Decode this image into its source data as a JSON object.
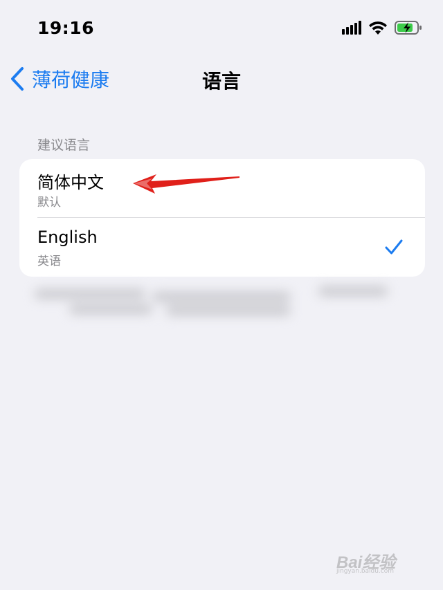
{
  "status_bar": {
    "time": "19:16"
  },
  "nav": {
    "back_label": "薄荷健康",
    "title": "语言"
  },
  "section": {
    "header": "建议语言"
  },
  "languages": [
    {
      "title": "简体中文",
      "subtitle": "默认",
      "selected": false
    },
    {
      "title": "English",
      "subtitle": "英语",
      "selected": true
    }
  ],
  "colors": {
    "accent": "#1c7cf0",
    "background": "#f1f1f6",
    "card": "#ffffff",
    "secondary_text": "#8a8a8e",
    "annotation": "#e0201a"
  },
  "icons": {
    "back": "chevron-left-icon",
    "check": "checkmark-icon",
    "signal": "cellular-signal-icon",
    "wifi": "wifi-icon",
    "battery": "battery-charging-icon",
    "annotation": "red-arrow-icon"
  },
  "watermark": {
    "text": "Bai经验",
    "sub": "jingyan.baidu.com"
  }
}
